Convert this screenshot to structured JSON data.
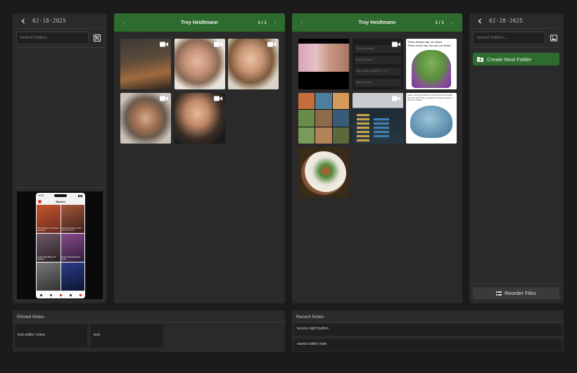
{
  "left_sidebar": {
    "date": "02-18-2025",
    "search_placeholder": "Search folders..."
  },
  "right_sidebar": {
    "date": "02-28-2025",
    "search_placeholder": "Search folders...",
    "create_label": "Create Next Folder",
    "reorder_label": "Reorder Files"
  },
  "viewer_left": {
    "title": "Troy Heidtmann",
    "count": "1 / 1"
  },
  "viewer_right": {
    "title": "Troy Heidtmann",
    "count": "1 / 1",
    "form_fields": [
      "First/Last Name*",
      "Email Address*",
      "Date of Birth (MM/DD/YYYY)*",
      "Agent Provider"
    ],
    "meme_top_text": "Them always say: ok retard\nThem never say: are you ok retard",
    "meme_bottom_text": "you're, the guys have fun for a minute the whole time. Do you have a problem? It doesn't apply to me it's a matter."
  },
  "phone_preview": {
    "time": "5:38",
    "app_title": "Stories",
    "card_captions": [
      "How Trainees in the Game Heal their...",
      "Telling My Partner & Tou Turn Tot The Ki...",
      "Lovely Suite Bring and Hangout...",
      "Dinner's Big Update for Junior"
    ]
  },
  "pinned_notes": {
    "label": "Pinned Notes",
    "items": [
      "test editor notes",
      "test"
    ]
  },
  "recent_notes": {
    "label": "Recent Notes",
    "items": [
      "tessss right button",
      "saved editor note"
    ]
  },
  "colors": {
    "accent_green": "#2e6b2e",
    "panel": "#2a2a2a",
    "background": "#1b1b1b"
  }
}
